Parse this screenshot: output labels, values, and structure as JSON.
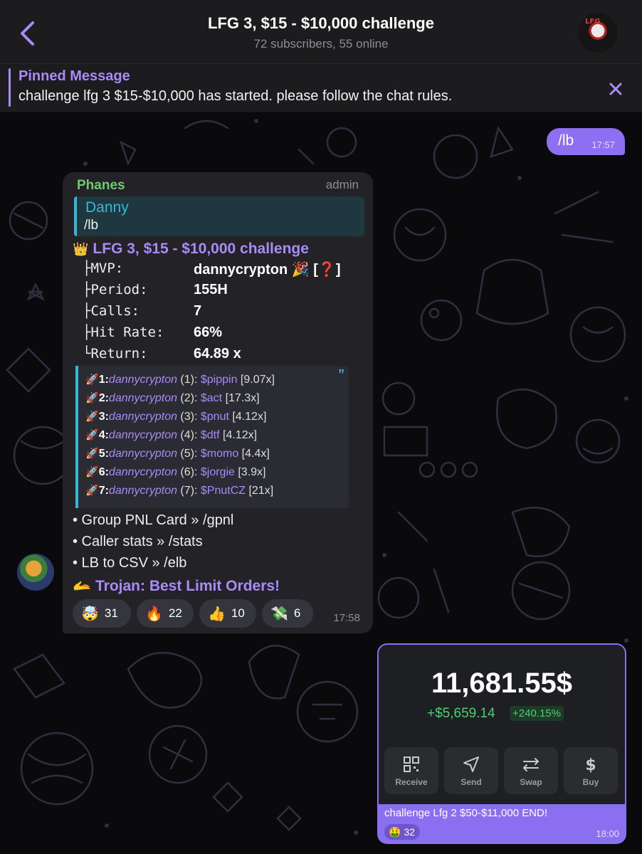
{
  "header": {
    "title": "LFG 3, $15 - $10,000 challenge",
    "subtitle": "72 subscribers, 55 online",
    "avatar_text": "LFG"
  },
  "pinned": {
    "label": "Pinned Message",
    "text": "challenge lfg 3 $15-$10,000 has started. please follow the chat rules."
  },
  "outgoing": {
    "text": "/lb",
    "time": "17:57"
  },
  "bot_message": {
    "sender": "Phanes",
    "role": "admin",
    "reply": {
      "name": "Danny",
      "text": "/lb"
    },
    "title": "LFG 3, $15 - $10,000 challenge",
    "stats": [
      {
        "label": "├MVP:",
        "value": "dannycrypton 🎉 [❓]"
      },
      {
        "label": "├Period:",
        "value": "155H"
      },
      {
        "label": "├Calls:",
        "value": "7"
      },
      {
        "label": "├Hit Rate:",
        "value": "66%"
      },
      {
        "label": "└Return:",
        "value": "64.89 x"
      }
    ],
    "calls": [
      {
        "num": "1:",
        "user": "dannycrypton",
        "idx": " (1): ",
        "token": "$pippin",
        "mult": " [9.07x]"
      },
      {
        "num": "2:",
        "user": "dannycrypton",
        "idx": " (2): ",
        "token": "$act",
        "mult": " [17.3x]"
      },
      {
        "num": "3:",
        "user": "dannycrypton",
        "idx": " (3): ",
        "token": "$pnut",
        "mult": " [4.12x]"
      },
      {
        "num": "4:",
        "user": "dannycrypton",
        "idx": " (4): ",
        "token": "$dtf",
        "mult": " [4.12x]"
      },
      {
        "num": "5:",
        "user": "dannycrypton",
        "idx": " (5): ",
        "token": "$momo",
        "mult": " [4.4x]"
      },
      {
        "num": "6:",
        "user": "dannycrypton",
        "idx": " (6): ",
        "token": "$jorgie",
        "mult": " [3.9x]"
      },
      {
        "num": "7:",
        "user": "dannycrypton",
        "idx": " (7): ",
        "token": "$PnutCZ",
        "mult": " [21x]"
      }
    ],
    "commands": [
      "• Group PNL Card » /gpnl",
      "• Caller stats » /stats",
      "• LB to CSV » /elb"
    ],
    "trojan": "Trojan: Best Limit Orders!",
    "reactions": [
      {
        "emoji": "🤯",
        "count": "31"
      },
      {
        "emoji": "🔥",
        "count": "22"
      },
      {
        "emoji": "👍",
        "count": "10"
      },
      {
        "emoji": "💸",
        "count": "6"
      }
    ],
    "time": "17:58"
  },
  "pnl_card": {
    "amount": "11,681.55$",
    "pnl": "+$5,659.14",
    "pct": "+240.15%",
    "buttons": [
      {
        "label": "Receive",
        "icon": "qr-icon"
      },
      {
        "label": "Send",
        "icon": "send-icon"
      },
      {
        "label": "Swap",
        "icon": "swap-icon"
      },
      {
        "label": "Buy",
        "icon": "dollar-icon"
      }
    ],
    "caption": "challenge Lfg 2 $50-$11,000 END!",
    "reaction": {
      "emoji": "🤑",
      "count": "32"
    },
    "time": "18:00"
  },
  "colors": {
    "accent": "#a88bf7",
    "outgoing_bubble": "#8d6ff2",
    "sender_green": "#6fca6f",
    "quote_blue": "#37b6d6",
    "profit_green": "#4ccf6f"
  }
}
